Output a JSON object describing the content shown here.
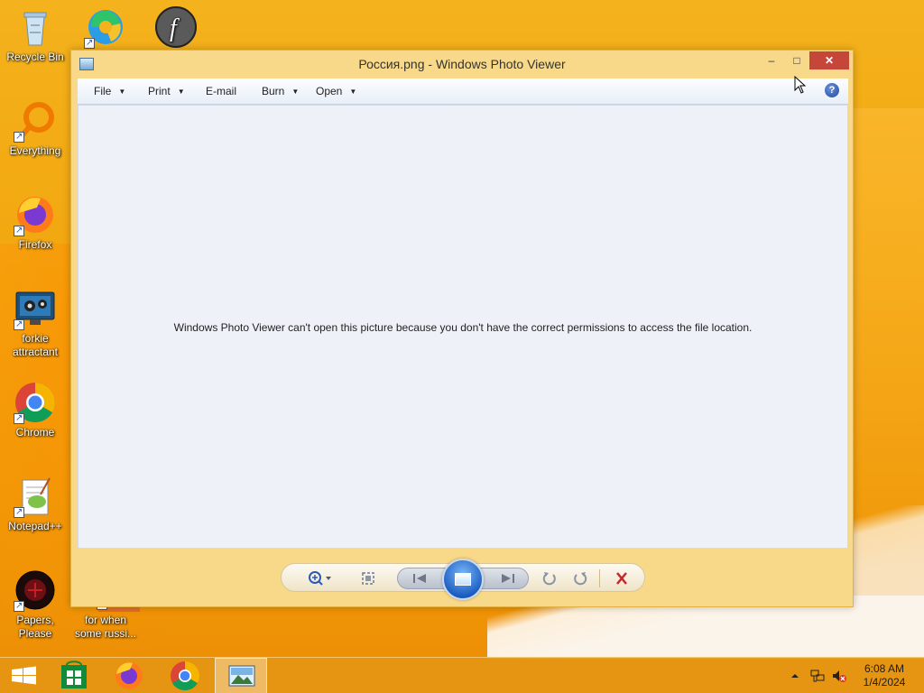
{
  "desktop": {
    "icons": [
      {
        "label": "Recycle Bin",
        "name": "recycle-bin-icon"
      },
      {
        "label": "",
        "name": "edge-browser-icon"
      },
      {
        "label": "",
        "name": "flash-player-icon"
      },
      {
        "label": "Everything",
        "name": "everything-search-icon"
      },
      {
        "label": "Firefox",
        "name": "firefox-icon"
      },
      {
        "label": "forkie attractant",
        "name": "settings-monitor-icon"
      },
      {
        "label": "Chrome",
        "name": "chrome-icon"
      },
      {
        "label": "Notepad++",
        "name": "notepad-plus-plus-icon"
      },
      {
        "label": "Papers, Please",
        "name": "papers-please-icon"
      },
      {
        "label": "for when some russi...",
        "name": "folder-shortcut-icon"
      }
    ]
  },
  "window": {
    "title": "Россия.png - Windows Photo Viewer",
    "buttons": {
      "minimize": "–",
      "maximize": "□",
      "close": "✕"
    },
    "menu": [
      {
        "label": "File",
        "has_dropdown": true
      },
      {
        "label": "Print",
        "has_dropdown": true
      },
      {
        "label": "E-mail",
        "has_dropdown": false
      },
      {
        "label": "Burn",
        "has_dropdown": true
      },
      {
        "label": "Open",
        "has_dropdown": true
      }
    ],
    "help_label": "?",
    "message": "Windows Photo Viewer can't open this picture because you don't have the correct permissions to access the file location.",
    "controls": {
      "zoom": "zoom-icon",
      "actual_size": "actual-size-icon",
      "previous": "previous-icon",
      "slideshow": "slideshow-icon",
      "next": "next-icon",
      "rotate_ccw": "rotate-counterclockwise-icon",
      "rotate_cw": "rotate-clockwise-icon",
      "delete": "delete-icon"
    }
  },
  "taskbar": {
    "buttons": [
      "start-icon",
      "store-icon",
      "firefox-icon",
      "chrome-icon",
      "photo-viewer-icon"
    ],
    "tray": {
      "time": "6:08 AM",
      "date": "1/4/2024"
    }
  },
  "colors": {
    "accent": "#f2a60f",
    "close": "#c7463a",
    "viewer_bg": "#eef1f8"
  }
}
